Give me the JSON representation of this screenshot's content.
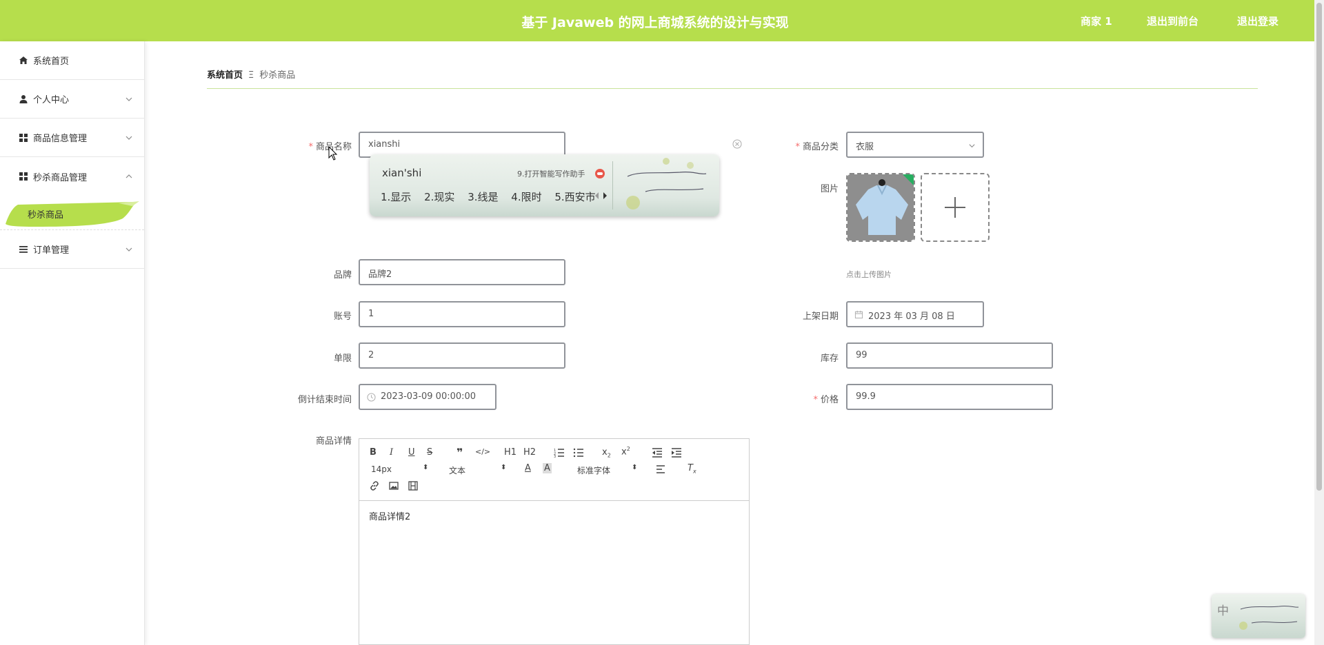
{
  "header": {
    "title": "基于 Javaweb 的网上商城系统的设计与实现",
    "user": "商家 1",
    "to_front": "退出到前台",
    "logout": "退出登录"
  },
  "sidebar": {
    "items": [
      {
        "label": "系统首页",
        "icon": "home-icon"
      },
      {
        "label": "个人中心",
        "icon": "user-icon"
      },
      {
        "label": "商品信息管理",
        "icon": "grid-icon"
      },
      {
        "label": "秒杀商品管理",
        "icon": "grid-icon"
      },
      {
        "label": "订单管理",
        "icon": "list-icon"
      }
    ],
    "active_sub": "秒杀商品"
  },
  "breadcrumb": {
    "home": "系统首页",
    "separator": "Ξ",
    "current": "秒杀商品"
  },
  "form": {
    "name_label": "商品名称",
    "name_value": "xianshi",
    "category_label": "商品分类",
    "category_value": "衣服",
    "image_label": "图片",
    "upload_hint": "点击上传图片",
    "brand_label": "品牌",
    "brand_value": "品牌2",
    "account_label": "账号",
    "account_value": "1",
    "date_label": "上架日期",
    "date_value": "2023 年 03 月 08 日",
    "limit_label": "单限",
    "limit_value": "2",
    "stock_label": "库存",
    "stock_value": "99",
    "countdown_label": "倒计结束时间",
    "countdown_value": "2023-03-09 00:00:00",
    "price_label": "价格",
    "price_value": "99.9",
    "detail_label": "商品详情"
  },
  "editor": {
    "font_size": "14px",
    "block_type": "文本",
    "font_family": "标准字体",
    "content": "商品详情2",
    "h1": "H1",
    "h2": "H2"
  },
  "ime": {
    "pinyin": "xian'shi",
    "assist": "9.打开智能写作助手",
    "candidates": [
      "1.显示",
      "2.现实",
      "3.线是",
      "4.限时",
      "5.西安市"
    ],
    "mini_label": "中"
  },
  "colors": {
    "accent": "#b6de4c",
    "required": "#f56c6c"
  }
}
